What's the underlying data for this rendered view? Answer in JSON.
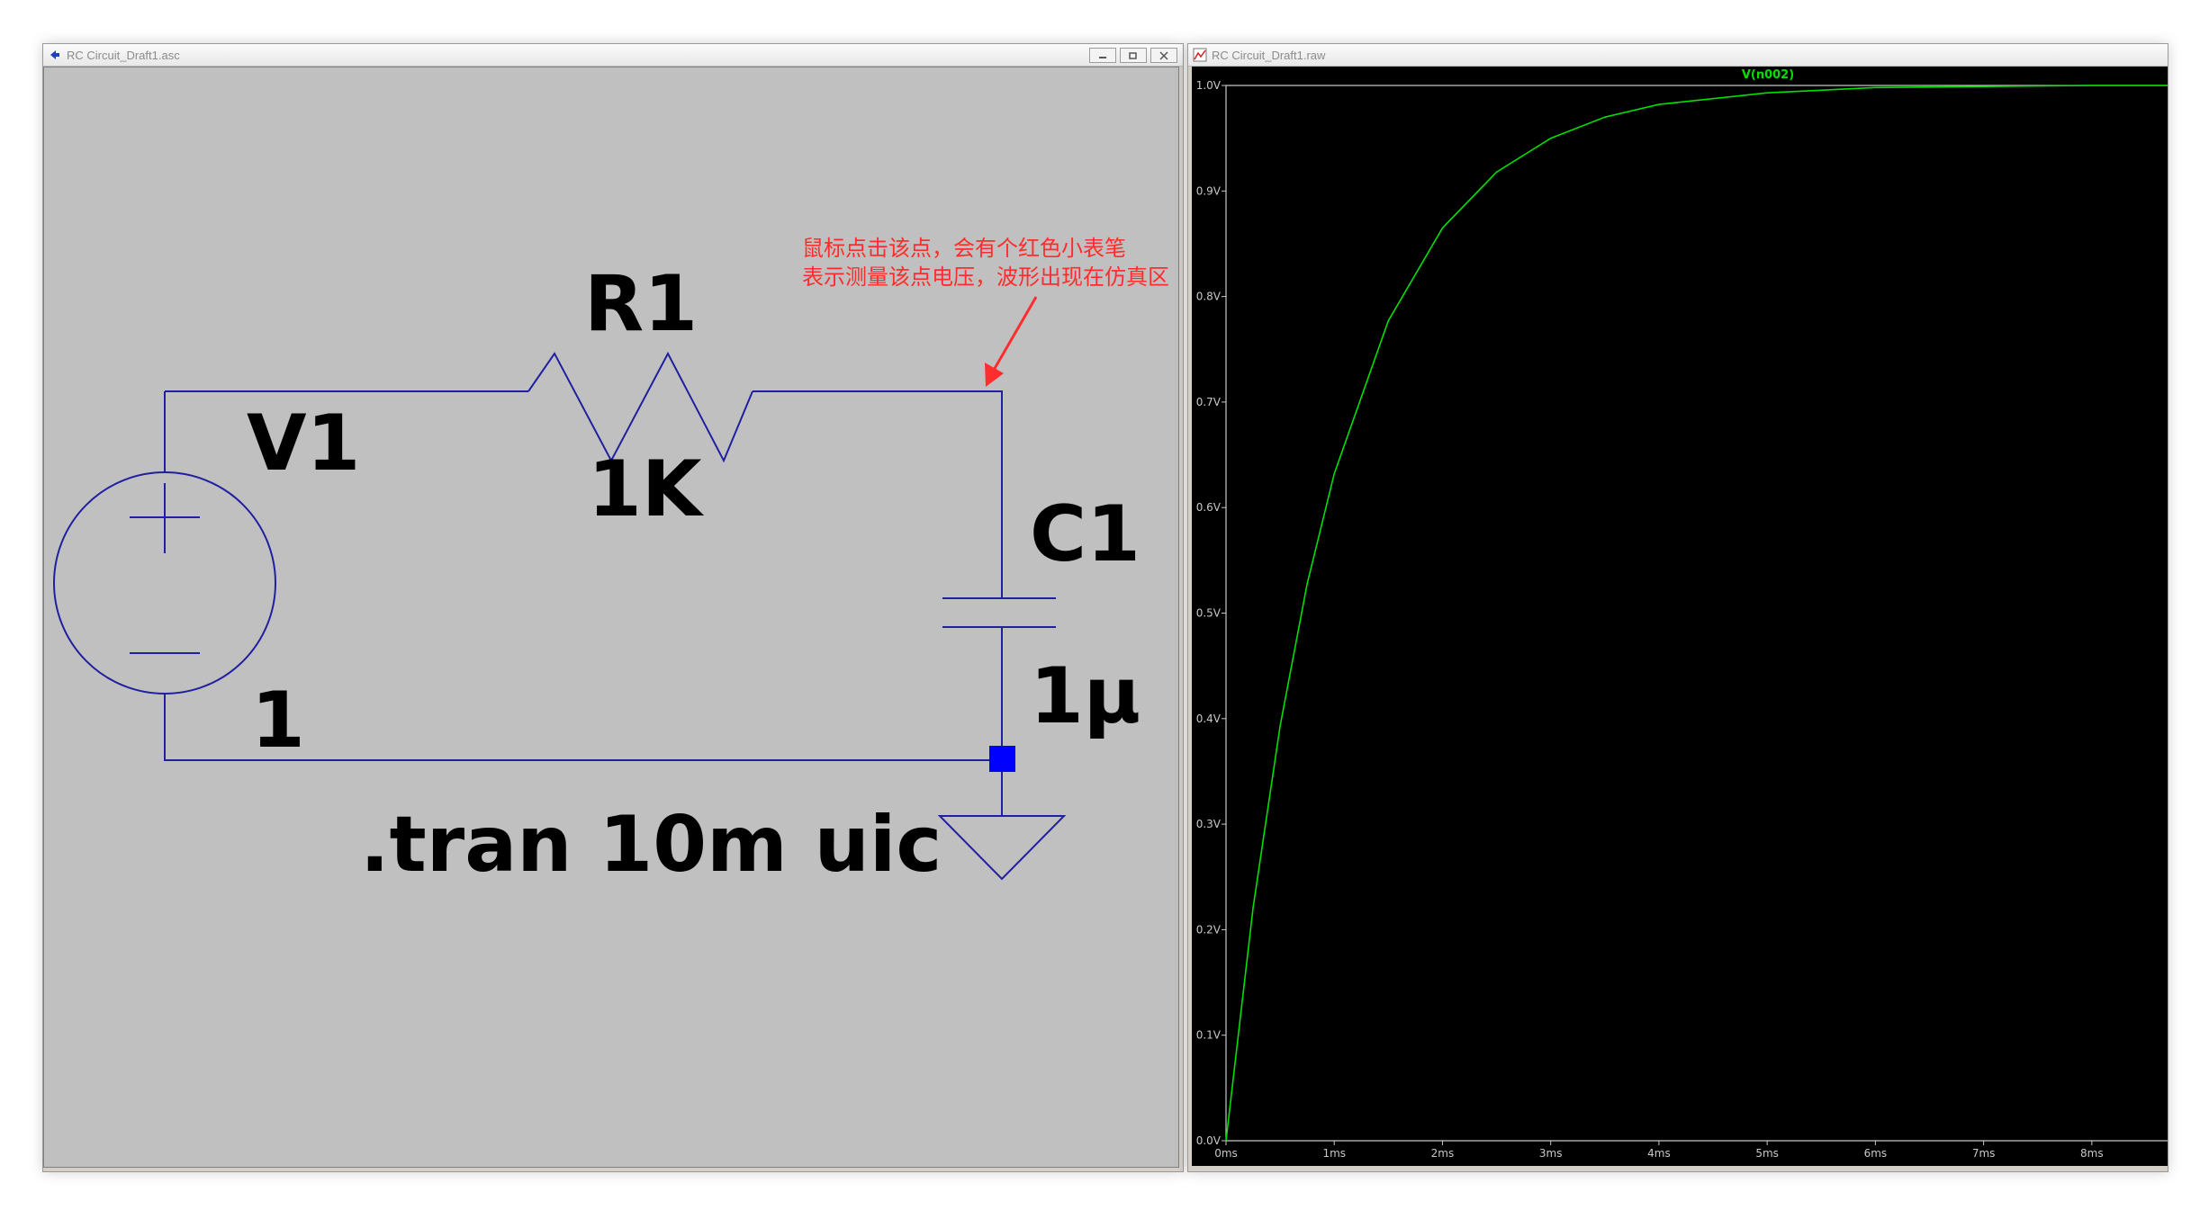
{
  "schematic_window": {
    "title": "RC Circuit_Draft1.asc",
    "components": {
      "source": {
        "name": "V1",
        "value": "1"
      },
      "resistor": {
        "name": "R1",
        "value": "1K"
      },
      "capacitor": {
        "name": "C1",
        "value": "1μ"
      }
    },
    "directive": ".tran 10m uic",
    "annotation": {
      "line1": "鼠标点击该点，会有个红色小表笔",
      "line2": "表示测量该点电压，波形出现在仿真区"
    },
    "colors": {
      "background": "#c0c0c0",
      "wire": "#2020a0",
      "node": "#0000ff",
      "annotation": "#ff2d2d"
    }
  },
  "waveform_window": {
    "title": "RC Circuit_Draft1.raw",
    "trace_label": "V(n002)",
    "colors": {
      "background": "#000000",
      "trace": "#00e000",
      "axis": "#c8c8c8"
    }
  },
  "chart_data": {
    "type": "line",
    "title": "V(n002)",
    "xlabel": "",
    "ylabel": "",
    "x_ticks": [
      "0ms",
      "1ms",
      "2ms",
      "3ms",
      "4ms",
      "5ms",
      "6ms",
      "7ms",
      "8ms"
    ],
    "y_ticks": [
      "0.0V",
      "0.1V",
      "0.2V",
      "0.3V",
      "0.4V",
      "0.5V",
      "0.6V",
      "0.7V",
      "0.8V",
      "0.9V",
      "1.0V"
    ],
    "xlim": [
      0,
      8.7
    ],
    "ylim": [
      0,
      1.0
    ],
    "series": [
      {
        "name": "V(n002)",
        "x": [
          0,
          0.25,
          0.5,
          0.75,
          1,
          1.5,
          2,
          2.5,
          3,
          3.5,
          4,
          5,
          6,
          7,
          8,
          8.7
        ],
        "y": [
          0,
          0.221,
          0.393,
          0.528,
          0.632,
          0.777,
          0.865,
          0.918,
          0.95,
          0.97,
          0.982,
          0.993,
          0.998,
          0.999,
          1.0,
          1.0
        ]
      }
    ]
  }
}
